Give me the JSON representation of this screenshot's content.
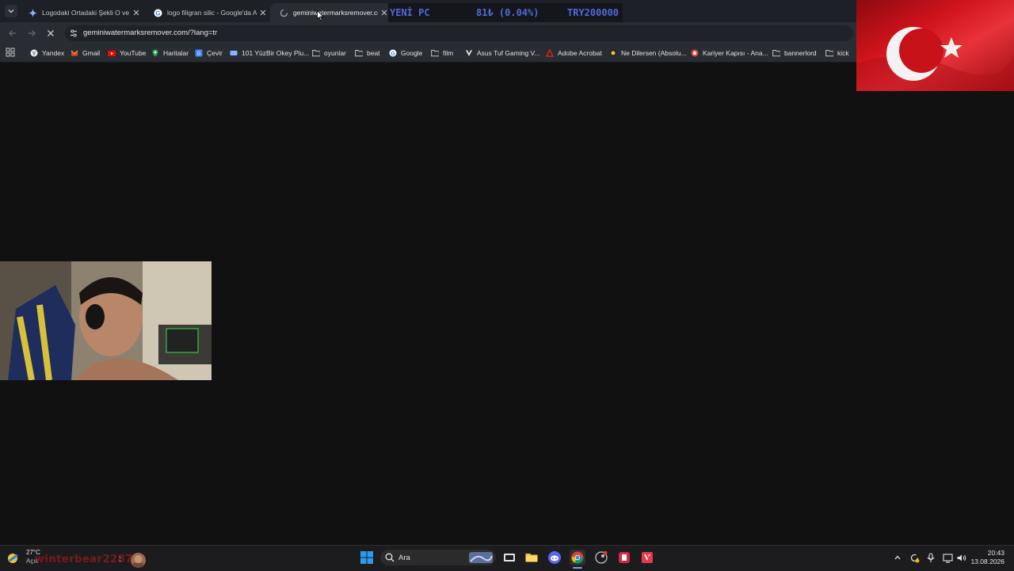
{
  "browser": {
    "tabs": [
      {
        "title": "Logodaki Ortadaki Şekli O ve B",
        "icon": "gemini-icon"
      },
      {
        "title": "logo filigran silic - Google'da Ar",
        "icon": "google-icon"
      },
      {
        "title": "geminiwatermarksremover.com",
        "icon": "loading-icon",
        "active": true
      }
    ],
    "address_bar": {
      "url": "geminiwatermarksremover.com/?lang=tr"
    },
    "bookmarks": [
      {
        "label": "Yandex",
        "icon": "yandex-icon"
      },
      {
        "label": "Gmail",
        "icon": "gmail-icon"
      },
      {
        "label": "YouTube",
        "icon": "youtube-icon"
      },
      {
        "label": "Haritalar",
        "icon": "maps-icon"
      },
      {
        "label": "Çevir",
        "icon": "translate-icon"
      },
      {
        "label": "101 YüzBir Okey Plu...",
        "icon": "okey-icon"
      },
      {
        "label": "oyunlar",
        "icon": "folder-icon"
      },
      {
        "label": "beat",
        "icon": "folder-icon"
      },
      {
        "label": "Google",
        "icon": "google-icon"
      },
      {
        "label": "film",
        "icon": "folder-icon"
      },
      {
        "label": "Asus Tuf Gaming V...",
        "icon": "v-icon"
      },
      {
        "label": "Adobe Acrobat",
        "icon": "acrobat-icon"
      },
      {
        "label": "Ne Dilersen (Absolu...",
        "icon": "circle-icon"
      },
      {
        "label": "Kariyer Kapısı - Ana...",
        "icon": "kariyer-icon"
      },
      {
        "label": "bannerlord",
        "icon": "folder-icon"
      },
      {
        "label": "kick",
        "icon": "folder-icon"
      }
    ]
  },
  "stream_overlay": {
    "ticker": {
      "left": "YENİ PC",
      "middle": "81₺ (0.04%)",
      "right": "TRY200000"
    },
    "streamer_name": "winterbear2287",
    "colors": {
      "ticker_text": "#4f6ad8",
      "flag_red": "#d0131c"
    }
  },
  "taskbar": {
    "weather": {
      "temp": "27°C",
      "condition": "Açık"
    },
    "search_placeholder": "Ara",
    "clock": {
      "time": "20:43",
      "date": "13.08.2026"
    }
  }
}
